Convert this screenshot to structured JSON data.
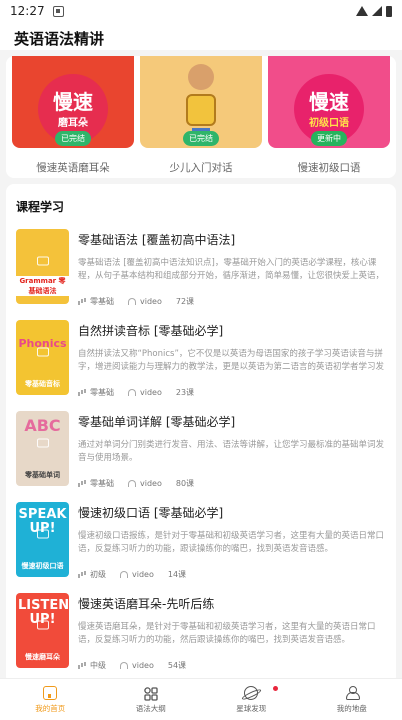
{
  "status_bar": {
    "time": "12:27"
  },
  "header": {
    "title": "英语语法精讲"
  },
  "featured": [
    {
      "title": "慢速英语磨耳朵",
      "cover_big": "慢速",
      "cover_small": "磨耳朵",
      "badge": "已完结"
    },
    {
      "title": "少儿入门对话",
      "badge": "已完结"
    },
    {
      "title": "慢速初级口语",
      "cover_big": "慢速",
      "cover_small": "初级口语",
      "badge": "更新中"
    }
  ],
  "section": {
    "title": "课程学习"
  },
  "courses": [
    {
      "title": "零基础语法 [覆盖初高中语法]",
      "desc": "零基础语法 [覆盖初高中语法知识点]，零基础开始入门的英语必学课程，核心课程，从句子基本结构和组成部分开始，循序渐进，简单易懂，让您很快爱上英语，发现英语语法...",
      "level": "零基础",
      "type": "video",
      "count": "72课",
      "cover_big": "",
      "cover_text": "Grammar 零基础语法"
    },
    {
      "title": "自然拼读音标 [零基础必学]",
      "desc": "自然拼读法又称“Phonics”，它不仅是以英语为母语国家的孩子学习英语读音与拼字，增进阅读能力与理解力的教学法，更是以英语为第二语言的英语初学者学习发音规则与拼...",
      "level": "零基础",
      "type": "video",
      "count": "23课",
      "cover_big": "Phonics",
      "cover_text": "零基础音标"
    },
    {
      "title": "零基础单词详解 [零基础必学]",
      "desc": "通过对单词分门别类进行发音、用法、语法等讲解，让您学习最标准的基础单词发音与使用场景。",
      "level": "零基础",
      "type": "video",
      "count": "80课",
      "cover_big": "ABC",
      "cover_text": "零基础单词"
    },
    {
      "title": "慢速初级口语 [零基础必学]",
      "desc": "慢速初级口语报练，是针对于零基础和初级英语学习者，这里有大量的英语日常口语，反复练习听力的功能，跟读操练你的嘴巴，找到英语发音语感。",
      "level": "初级",
      "type": "video",
      "count": "14课",
      "cover_big": "SPEAK UP!",
      "cover_text": "慢速初级口语"
    },
    {
      "title": "慢速英语磨耳朵-先听后练",
      "desc": "慢速英语磨耳朵，是针对于零基础和初级英语学习者，这里有大量的英语日常口语，反复练习听力的功能，然后跟读操练你的嘴巴，找到英语发音语感。",
      "level": "中级",
      "type": "video",
      "count": "54课",
      "cover_big": "LISTEN UP!",
      "cover_text": "慢速磨耳朵"
    }
  ],
  "tabs": [
    {
      "label": "我的首页",
      "icon": "home-icon",
      "active": true
    },
    {
      "label": "语法大纲",
      "icon": "grid-icon",
      "active": false
    },
    {
      "label": "星球发现",
      "icon": "planet-icon",
      "active": false
    },
    {
      "label": "我的地盘",
      "icon": "user-icon",
      "active": false
    }
  ],
  "colors": {
    "accent": "#f09a1a",
    "badge_green": "#2fb56a",
    "notification_dot": "#e8263c"
  }
}
